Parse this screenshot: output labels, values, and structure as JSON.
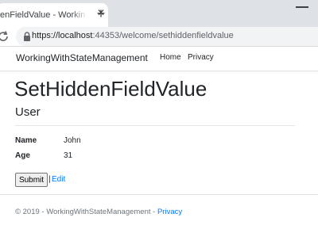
{
  "browser": {
    "tab_title": "enFieldValue - WorkingW",
    "close_glyph": "✕",
    "new_tab_glyph": "+",
    "url_prefix": "https://localhost",
    "url_rest": ":44353/welcome/sethiddenfieldvalue"
  },
  "nav": {
    "brand": "WorkingWithStateManagement",
    "links": [
      "Home",
      "Privacy"
    ]
  },
  "page": {
    "title": "SetHiddenFieldValue",
    "section": "User",
    "fields": [
      {
        "label": "Name",
        "value": "John"
      },
      {
        "label": "Age",
        "value": "31"
      }
    ],
    "submit_label": "Submit",
    "separator": "|",
    "edit_label": "Edit"
  },
  "footer": {
    "copyright": "© 2019 - WorkingWithStateManagement - ",
    "privacy": "Privacy"
  },
  "colors": {
    "link": "#007bff",
    "tabstrip": "#dee1e6",
    "omnibox": "#f1f3f4"
  },
  "icons": [
    "reload-icon",
    "lock-icon",
    "close-icon",
    "new-tab-icon",
    "minimize-icon"
  ]
}
